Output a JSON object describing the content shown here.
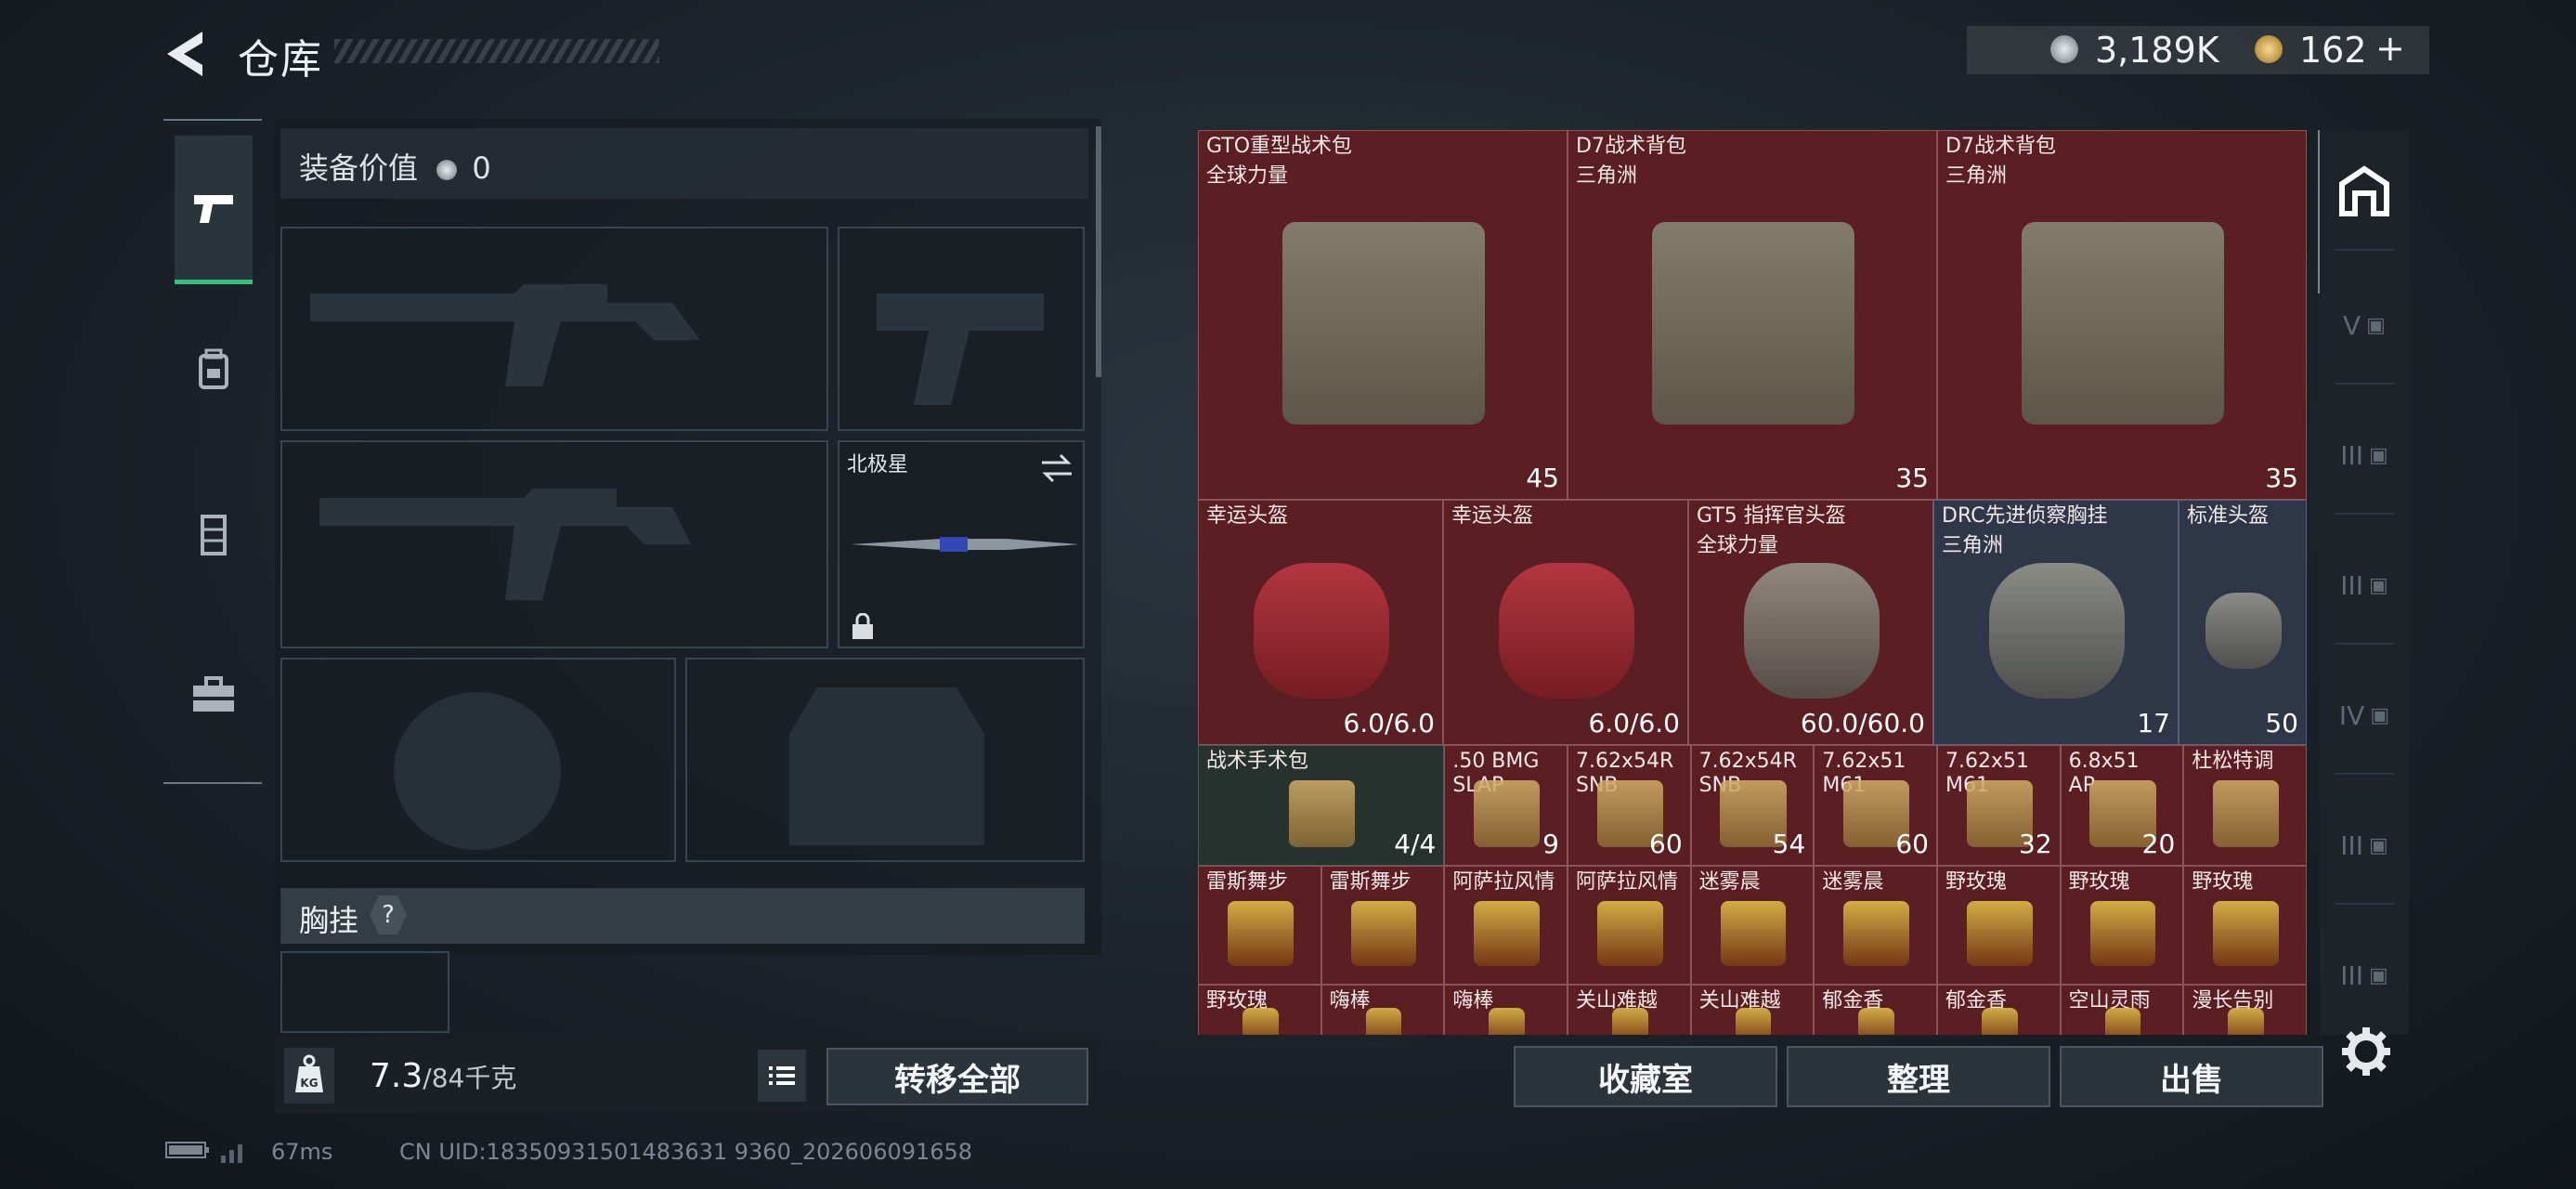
{
  "header": {
    "title": "仓库",
    "currency_silver": "3,189K",
    "currency_gold": "162",
    "add_symbol": "+"
  },
  "loadout": {
    "equip_value_label": "装备价值",
    "equip_value": "0",
    "melee_name": "北极星",
    "chest_label": "胸挂",
    "help_symbol": "?"
  },
  "footer": {
    "weight_current": "7.3",
    "weight_max": "/84",
    "weight_unit": "千克",
    "transfer_all": "转移全部",
    "ping": "67ms",
    "uid": "CN UID:18350931501483631 9360_202606091658"
  },
  "actions": {
    "collection": "收藏室",
    "organize": "整理",
    "sell": "出售"
  },
  "items": [
    {
      "name": "GTO重型战术包",
      "sub": "全球力量",
      "value": "45",
      "icon": "capacity-icon"
    },
    {
      "name": "D7战术背包",
      "sub": "三角洲",
      "value": "35",
      "icon": "capacity-icon"
    },
    {
      "name": "D7战术背包",
      "sub": "三角洲",
      "value": "35",
      "icon": "capacity-icon"
    },
    {
      "name": "幸运头盔",
      "sub": "",
      "value": "6.0/6.0"
    },
    {
      "name": "幸运头盔",
      "sub": "",
      "value": "6.0/6.0"
    },
    {
      "name": "GT5 指挥官头盔",
      "sub": "全球力量",
      "value": "60.0/60.0"
    },
    {
      "name": "DRC先进侦察胸挂",
      "sub": "三角洲",
      "value": "17"
    },
    {
      "name": "标准头盔",
      "sub": "",
      "value": "50"
    },
    {
      "name": "战术手术包",
      "sub": "",
      "value": "4/4"
    },
    {
      "name": ".50 BMG",
      "sub": "SLAP",
      "value": "9"
    },
    {
      "name": "7.62x54R",
      "sub": "SNB",
      "value": "60"
    },
    {
      "name": "7.62x54R",
      "sub": "SNB",
      "value": "54"
    },
    {
      "name": "7.62x51",
      "sub": "M61",
      "value": "60"
    },
    {
      "name": "7.62x51",
      "sub": "M61",
      "value": "32"
    },
    {
      "name": "6.8x51",
      "sub": "AP",
      "value": "20"
    },
    {
      "name": "杜松特调",
      "sub": "",
      "value": ""
    },
    {
      "name": "雷斯舞步",
      "sub": "",
      "value": ""
    },
    {
      "name": "雷斯舞步",
      "sub": "",
      "value": ""
    },
    {
      "name": "阿萨拉风情",
      "sub": "",
      "value": ""
    },
    {
      "name": "阿萨拉风情",
      "sub": "",
      "value": ""
    },
    {
      "name": "迷雾晨",
      "sub": "",
      "value": ""
    },
    {
      "name": "迷雾晨",
      "sub": "",
      "value": ""
    },
    {
      "name": "野玫瑰",
      "sub": "",
      "value": ""
    },
    {
      "name": "野玫瑰",
      "sub": "",
      "value": ""
    },
    {
      "name": "野玫瑰",
      "sub": "",
      "value": ""
    },
    {
      "name": "野玫瑰",
      "sub": "",
      "value": ""
    },
    {
      "name": "嗨棒",
      "sub": "",
      "value": ""
    },
    {
      "name": "嗨棒",
      "sub": "",
      "value": ""
    },
    {
      "name": "关山难越",
      "sub": "",
      "value": ""
    },
    {
      "name": "关山难越",
      "sub": "",
      "value": ""
    },
    {
      "name": "郁金香",
      "sub": "",
      "value": ""
    },
    {
      "name": "郁金香",
      "sub": "",
      "value": ""
    },
    {
      "name": "空山灵雨",
      "sub": "",
      "value": ""
    },
    {
      "name": "漫长告别",
      "sub": "",
      "value": ""
    }
  ],
  "tool_rail": [
    "V",
    "III",
    "III",
    "IV",
    "III",
    "III"
  ]
}
